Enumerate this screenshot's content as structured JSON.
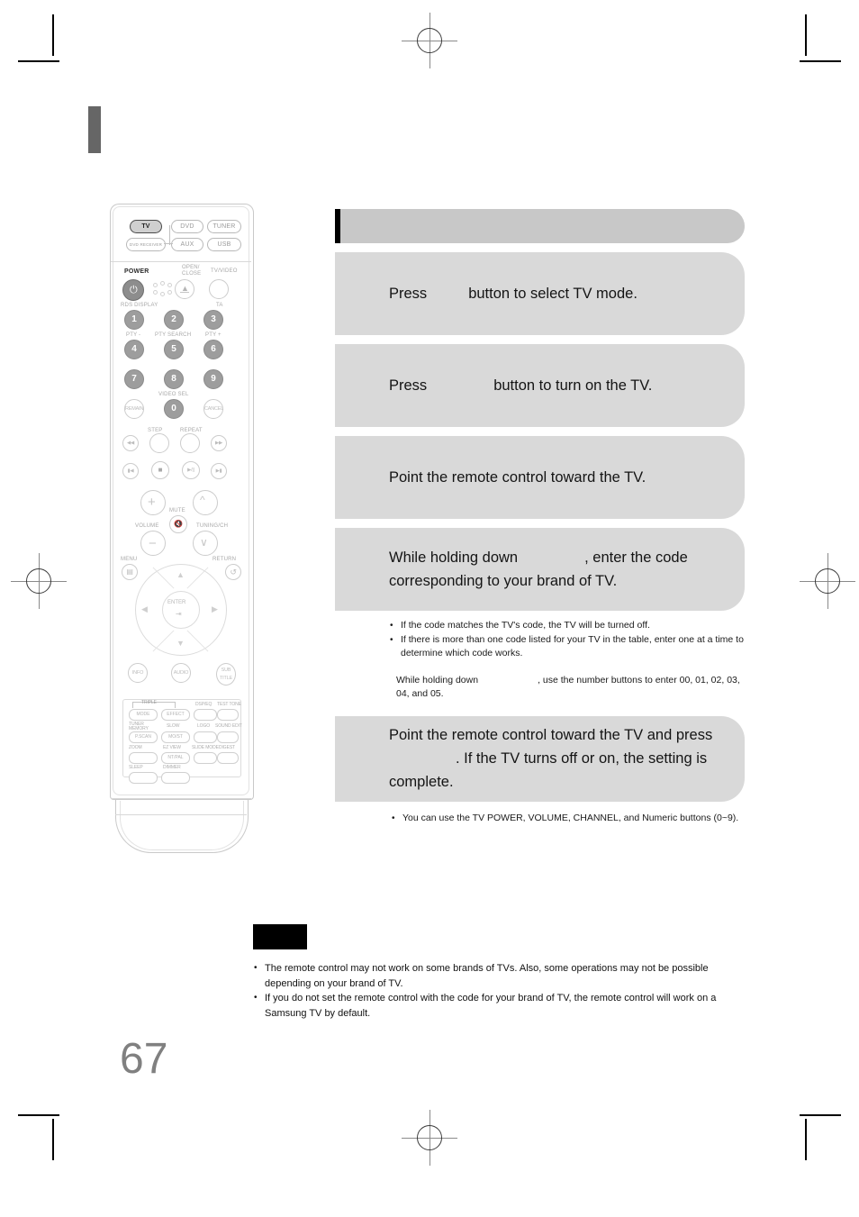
{
  "page": {
    "number": "67",
    "header_accent_color": "#666666"
  },
  "section": {
    "title": "",
    "title_bar_color": "#c8c8c8",
    "step_box_color": "#d9d9d9"
  },
  "steps": [
    {
      "id": "step-1",
      "before": "Press",
      "gap": "",
      "after": "button to select TV mode.",
      "gap_width": 46
    },
    {
      "id": "step-2",
      "before": "Press",
      "gap": "",
      "after": "button to turn on the TV.",
      "gap_width": 74
    },
    {
      "id": "step-3",
      "before": "Point the remote control toward the TV.",
      "gap": "",
      "after": "",
      "gap_width": 0
    },
    {
      "id": "step-4",
      "before": "While holding down",
      "gap": "",
      "after": ", enter the code corresponding to your brand of TV.",
      "gap_width": 74
    },
    {
      "id": "step-5",
      "before": "Point the remote control toward the TV and press",
      "gap": "",
      "after": ". If the TV turns off or on, the setting is complete.",
      "gap_width": 74
    }
  ],
  "step4_notes": [
    "If the code matches the TV's code, the TV will be turned off.",
    "If there is more than one code listed for your TV in the table, enter one at a time to determine which code works."
  ],
  "step4_plain": {
    "before": "While holding down",
    "after": ", use the number buttons to enter 00, 01, 02, 03, 04, and 05."
  },
  "step5_notes": [
    "You can use the TV POWER, VOLUME, CHANNEL, and Numeric buttons (0~9)."
  ],
  "bottom": {
    "flag_label": "",
    "notes": [
      "The remote control may not work on some brands of TVs. Also, some operations may not be possible depending on your brand of TV.",
      "If you do not set the remote control with the code for your brand of TV, the remote control will work on a Samsung TV by default."
    ]
  },
  "remote": {
    "source_buttons": [
      {
        "label": "TV",
        "selected": true
      },
      {
        "label": "DVD",
        "selected": false
      },
      {
        "label": "TUNER",
        "selected": false
      },
      {
        "label": "DVD RECEIVER",
        "selected": false
      },
      {
        "label": "AUX",
        "selected": false
      },
      {
        "label": "USB",
        "selected": false
      }
    ],
    "power_label": "POWER",
    "open_close_label": "OPEN/",
    "open_close_label2": "CLOSE",
    "tv_video_label": "TV/VIDEO",
    "rds_display_label": "RDS DISPLAY",
    "ta_label": "TA",
    "pty_minus_label": "PTY -",
    "pty_search_label": "PTY SEARCH",
    "pty_plus_label": "PTY +",
    "video_sel_label": "VIDEO SEL",
    "remain_label": "REMAIN",
    "cancel_label": "CANCEL",
    "numeric": [
      "1",
      "2",
      "3",
      "4",
      "5",
      "6",
      "7",
      "8",
      "9",
      "0"
    ],
    "step_label": "STEP",
    "repeat_label": "REPEAT",
    "volume_label": "VOLUME",
    "mute_label": "MUTE",
    "tuning_ch_label": "TUNING/CH",
    "menu_label": "MENU",
    "return_label": "RETURN",
    "enter_label": "ENTER",
    "info_label": "INFO",
    "audio_label": "AUDIO",
    "subtitle_label": "SUB",
    "subtitle_label2": "TITLE",
    "function_grid": [
      {
        "label": "MODE",
        "caption": "",
        "outlined": true
      },
      {
        "label": "EFFECT",
        "caption": "",
        "outlined": true
      },
      {
        "label": "",
        "caption": "DSP/EQ",
        "outlined": false
      },
      {
        "label": "",
        "caption": "TEST TONE",
        "outlined": false
      },
      {
        "label": "P.SCAN",
        "caption": "TUNER MEMORY",
        "outlined": true
      },
      {
        "label": "MO/ST",
        "caption": "SLOW",
        "outlined": true
      },
      {
        "label": "",
        "caption": "LOGO",
        "outlined": false
      },
      {
        "label": "",
        "caption": "SOUND EDIT",
        "outlined": false
      },
      {
        "label": "",
        "caption": "ZOOM",
        "outlined": false
      },
      {
        "label": "NT/PAL",
        "caption": "EZ VIEW",
        "outlined": true
      },
      {
        "label": "",
        "caption": "SLIDE MODE",
        "outlined": false
      },
      {
        "label": "",
        "caption": "DIGEST",
        "outlined": false
      },
      {
        "label": "",
        "caption": "SLEEP",
        "outlined": false
      },
      {
        "label": "",
        "caption": "DIMMER",
        "outlined": false
      }
    ],
    "triple_label": "TRIPLE"
  }
}
